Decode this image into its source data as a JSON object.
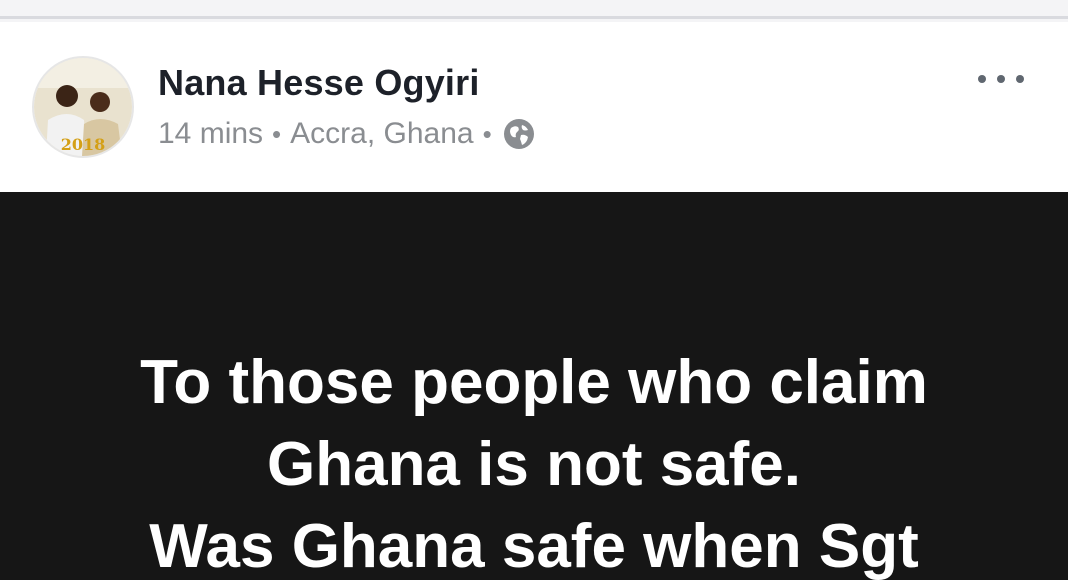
{
  "post": {
    "author": "Nana Hesse Ogyiri",
    "time": "14 mins",
    "location": "Accra, Ghana",
    "privacy_icon": "globe-icon",
    "more_icon": "more-options-icon",
    "avatar": {
      "caption": "2018"
    },
    "text_lines": [
      "To those people who claim",
      "Ghana is not safe.",
      "Was Ghana safe when Sgt"
    ]
  },
  "colors": {
    "author": "#1d2129",
    "meta": "#8a8d91",
    "body_background": "#161616",
    "body_text": "#ffffff"
  }
}
